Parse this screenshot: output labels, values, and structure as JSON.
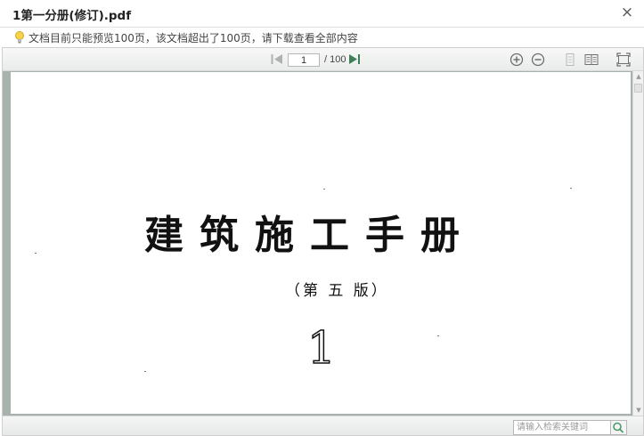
{
  "window": {
    "title": "1第一分册(修订).pdf",
    "close_label": "×"
  },
  "notice": {
    "text": "文档目前只能预览100页，该文档超出了100页，请下载查看全部内容",
    "icon": "lightbulb-icon"
  },
  "toolbar": {
    "current_page": "1",
    "page_total": "/ 100",
    "icons": [
      "prev-page-icon",
      "next-page-icon",
      "zoom-in-icon",
      "zoom-out-icon",
      "single-page-view-icon",
      "two-page-view-icon",
      "fullscreen-icon"
    ]
  },
  "document": {
    "book_title": "建筑施工手册",
    "edition": "（第 五 版）",
    "volume": "1"
  },
  "search": {
    "placeholder": "请输入检索关键词"
  },
  "colors": {
    "accent_green": "#4a9a6e",
    "doc_background": "#a9b3ad"
  }
}
